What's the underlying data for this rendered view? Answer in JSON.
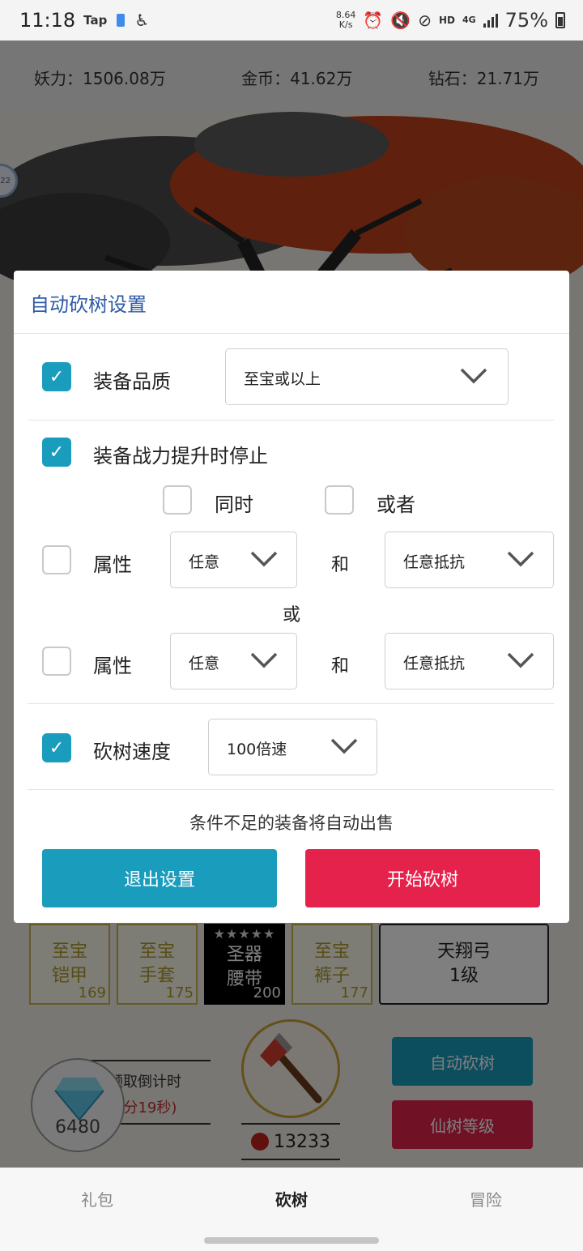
{
  "status_bar": {
    "time": "11:18",
    "app_badge": "Tap",
    "net_speed_value": "8.64",
    "net_speed_unit": "K/s",
    "hd": "HD",
    "network": "4G",
    "battery": "75%"
  },
  "resources": {
    "yaoli": "妖力：1506.08万",
    "gold": "金币：41.62万",
    "diamond": "钻石：21.71万"
  },
  "side_bubble": "22",
  "equipment": [
    {
      "line1": "至宝",
      "line2": "铠甲",
      "level": "169"
    },
    {
      "line1": "至宝",
      "line2": "手套",
      "level": "175"
    },
    {
      "stars": "★★★★★",
      "line1": "圣器",
      "line2": "腰带",
      "level": "200"
    },
    {
      "line1": "至宝",
      "line2": "裤子",
      "level": "177"
    }
  ],
  "weapon": {
    "name": "天翔弓",
    "level": "1级"
  },
  "diamond_reward": {
    "count": "6480",
    "label": "领取倒计时",
    "time": "(4分19秒)"
  },
  "apples": "13233",
  "actions": {
    "auto_chop": "自动砍树",
    "tree_level": "仙树等级"
  },
  "nav": {
    "gift": "礼包",
    "chop": "砍树",
    "adventure": "冒险"
  },
  "dialog": {
    "title": "自动砍树设置",
    "quality_label": "装备品质",
    "quality_value": "至宝或以上",
    "stop_label": "装备战力提升时停止",
    "simultaneous": "同时",
    "or_option": "或者",
    "attr1_label": "属性",
    "attr1_value": "任意",
    "and1": "和",
    "resist1_value": "任意抵抗",
    "or_text": "或",
    "attr2_label": "属性",
    "attr2_value": "任意",
    "and2": "和",
    "resist2_value": "任意抵抗",
    "speed_label": "砍树速度",
    "speed_value": "100倍速",
    "hint": "条件不足的装备将自动出售",
    "exit_button": "退出设置",
    "start_button": "开始砍树"
  },
  "colors": {
    "accent_blue": "#1a9cbd",
    "accent_red": "#e5224c",
    "title_blue": "#2e5aa8"
  }
}
